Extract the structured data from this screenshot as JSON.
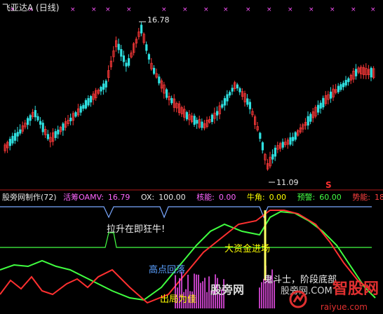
{
  "window": {
    "title": "飞亚达A (日线)"
  },
  "price_panel": {
    "high_label": "16.78",
    "low_label": "11.09",
    "signal_marker": "S",
    "colors": {
      "up": "#ff3a3a",
      "down": "#2fe0e0",
      "top_marks": "#ff55ff",
      "signal": "#ff3030"
    }
  },
  "indicator_header": {
    "name": "股旁网制作(72)",
    "items": [
      {
        "label": "活筹OAMV:",
        "value": "16.79",
        "color": "#ff66ff"
      },
      {
        "label": "OX:",
        "value": "100.00",
        "color": "#e8e8e8"
      },
      {
        "label": "核能:",
        "value": "0.00",
        "color": "#ff66ff"
      },
      {
        "label": "牛角:",
        "value": "0.00",
        "color": "#ffff00"
      },
      {
        "label": "预警:",
        "value": "60.00",
        "color": "#44ff44"
      },
      {
        "label": "势能:",
        "value": "18.34",
        "color": "#ff4040"
      }
    ]
  },
  "annotations": {
    "rise_text": "拉升在即狂牛!",
    "big_capital": "大资金进场",
    "high_fall": "高点回落",
    "exit_sell": "出局为佳",
    "stage_bottom": "鬼斗士，阶段底部"
  },
  "watermarks": {
    "site_text": "股旁网",
    "site_url_cn": "股旁网.COM",
    "logo_text": "智股网",
    "logo_url": "raiyue.com"
  }
}
